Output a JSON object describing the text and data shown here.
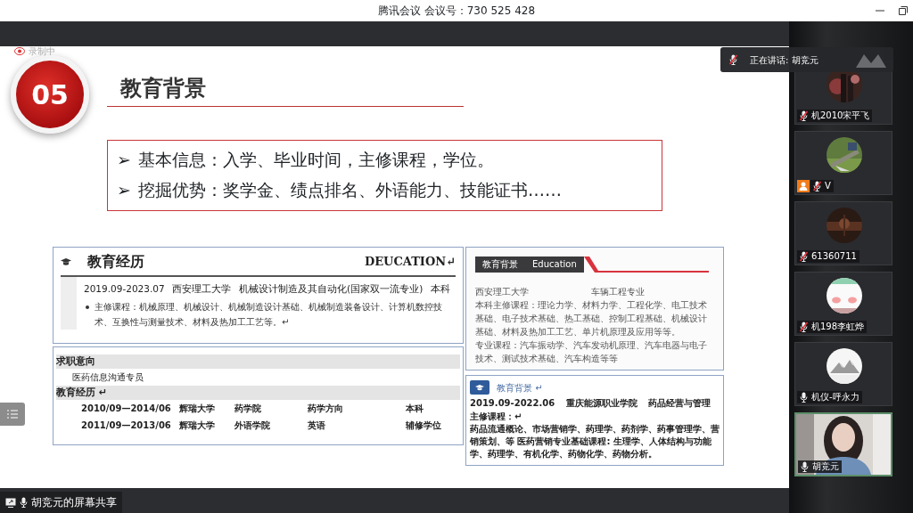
{
  "title_bar": {
    "title": "腾讯会议 会议号：730 525 428"
  },
  "speaking_banner": {
    "text": "正在讲话: 胡竞元"
  },
  "slide": {
    "recording_label": "录制中",
    "section_number": "05",
    "title": "教育背景",
    "bullets": [
      {
        "marker": "➢",
        "text": "基本信息：入学、毕业时间，主修课程，学位。"
      },
      {
        "marker": "➢",
        "text": "挖掘优势：奖学金、绩点排名、外语能力、技能证书……"
      }
    ],
    "resume_samples": [
      {
        "kind": "banner",
        "heading": "教育经历",
        "english": "DEUCATION↵",
        "row": [
          "2019.09-2023.07",
          "西安理工大学",
          "机械设计制造及其自动化(国家双一流专业)",
          "本科"
        ],
        "detail": "主修课程：机械原理、机械设计、机械制造设计基础、机械制造装备设计、计算机数控技术、互换性与测量技术、材料及热加工工艺等。↵"
      },
      {
        "kind": "table",
        "sections": [
          {
            "heading": "求职意向",
            "rows": [
              [
                "医药信息沟通专员"
              ]
            ]
          },
          {
            "heading": "教育经历 ↵",
            "rows": [
              [
                "2010/09—2014/06",
                "辉瑞大学",
                "药学院",
                "药学方向",
                "本科"
              ],
              [
                "2011/09—2013/06",
                "辉瑞大学",
                "外语学院",
                "英语",
                "辅修学位"
              ]
            ]
          }
        ]
      },
      {
        "kind": "ribbon",
        "heading": "教育背景",
        "english": "Education",
        "row": [
          "西安理工大学",
          "车辆工程专业"
        ],
        "paragraphs": [
          "本科主修课程：理论力学、材料力学、工程化学、电工技术基础、电子技术基础、热工基础、控制工程基础、机械设计基础、材料及热加工工艺、单片机原理及应用等等。",
          "专业课程：汽车振动学、汽车发动机原理、汽车电器与电子技术、测试技术基础、汽车构造等等"
        ]
      },
      {
        "kind": "icon_header",
        "heading": "教育背景 ↵",
        "row": [
          "2019.09-2022.06",
          "重庆能源职业学院",
          "药品经营与管理"
        ],
        "label": "主修课程：↵",
        "paragraphs": [
          "药品流通概论、市场营销学、药理学、药剂学、药事管理学、营销策划、等 医药营销专业基础课程: 生理学、人体结构与功能学、药理学、有机化学、药物化学、药物分析。"
        ]
      }
    ]
  },
  "participants": [
    {
      "kind": "avatar",
      "name": "机2010宋平飞",
      "muted": true,
      "host": false,
      "speaking": false
    },
    {
      "kind": "avatar",
      "name": "V",
      "muted": true,
      "host": true,
      "speaking": false
    },
    {
      "kind": "avatar",
      "name": "61360711",
      "muted": true,
      "host": false,
      "speaking": false
    },
    {
      "kind": "avatar",
      "name": "机198李虹烨",
      "muted": true,
      "host": false,
      "speaking": false
    },
    {
      "kind": "avatar",
      "name": "机仪-呼永力",
      "muted": false,
      "host": false,
      "speaking": false
    },
    {
      "kind": "video",
      "name": "胡竞元",
      "muted": false,
      "host": false,
      "speaking": true
    }
  ],
  "share_bar": {
    "label": "胡竞元的屏幕共享",
    "muted": false
  }
}
